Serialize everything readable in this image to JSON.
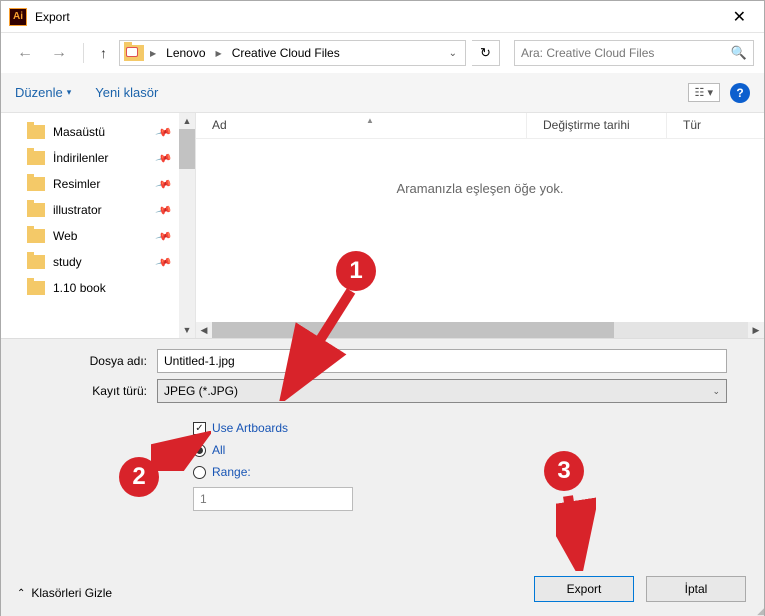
{
  "window": {
    "title": "Export",
    "close": "✕"
  },
  "nav": {
    "crumbs": [
      "Lenovo",
      "Creative Cloud Files"
    ],
    "search_placeholder": "Ara: Creative Cloud Files"
  },
  "toolbar": {
    "organize": "Düzenle",
    "new_folder": "Yeni klasör",
    "view_glyph": "☷ ▾"
  },
  "sidebar": {
    "items": [
      {
        "label": "Masaüstü"
      },
      {
        "label": "İndirilenler"
      },
      {
        "label": "Resimler"
      },
      {
        "label": "illustrator"
      },
      {
        "label": "Web"
      },
      {
        "label": "study"
      },
      {
        "label": "1.10 book"
      }
    ]
  },
  "columns": {
    "name": "Ad",
    "modified": "Değiştirme tarihi",
    "type": "Tür"
  },
  "empty_message": "Aramanızla eşleşen öğe yok.",
  "form": {
    "filename_label": "Dosya adı:",
    "filename_value": "Untitled-1.jpg",
    "savetype_label": "Kayıt türü:",
    "savetype_value": "JPEG (*.JPG)",
    "use_artboards": "Use Artboards",
    "all": "All",
    "range": "Range:",
    "range_value": "1"
  },
  "buttons": {
    "export": "Export",
    "cancel": "İptal"
  },
  "footer": {
    "hide_folders": "Klasörleri Gizle"
  },
  "annotations": {
    "b1": "1",
    "b2": "2",
    "b3": "3"
  }
}
